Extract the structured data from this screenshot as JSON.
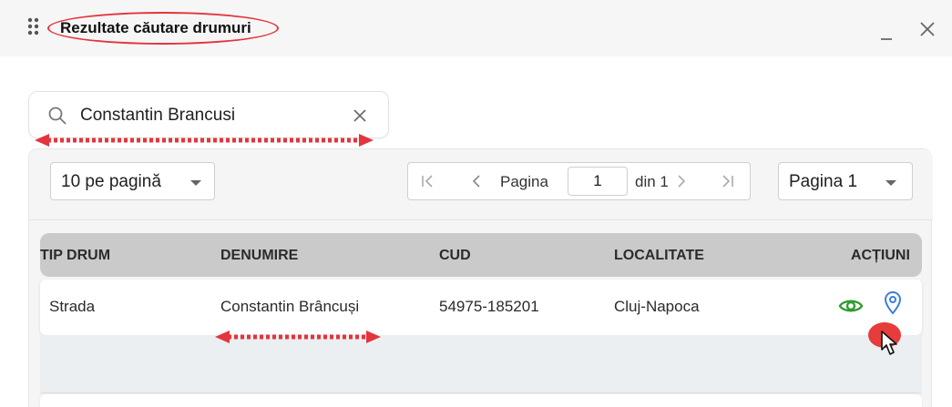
{
  "window": {
    "title": "Rezultate căutare drumuri",
    "drag_icon": "drag-handle-icon",
    "minimize_icon": "minimize-icon",
    "close_icon": "close-icon"
  },
  "search": {
    "value": "Constantin Brancusi",
    "icon": "search-icon",
    "clear_icon": "clear-icon"
  },
  "toolbar": {
    "per_page_label": "10  pe pagină",
    "pager": {
      "page_label": "Pagina",
      "current_page": "1",
      "of_label": "din 1"
    },
    "page_select_label": "Pagina 1"
  },
  "table": {
    "columns": [
      "TIP DRUM",
      "DENUMIRE",
      "CUD",
      "LOCALITATE",
      "ACȚIUNI"
    ],
    "rows": [
      {
        "tip_drum": "Strada",
        "denumire": "Constantin Brâncuși",
        "cud": "54975-185201",
        "localitate": "Cluj-Napoca",
        "actions": [
          "eye-icon",
          "map-pin-icon"
        ]
      }
    ]
  },
  "colors": {
    "annotation_red": "#e3353c",
    "eye_green": "#2e9d2e",
    "pin_blue": "#3b7ddd",
    "header_gray": "#cacaca"
  }
}
